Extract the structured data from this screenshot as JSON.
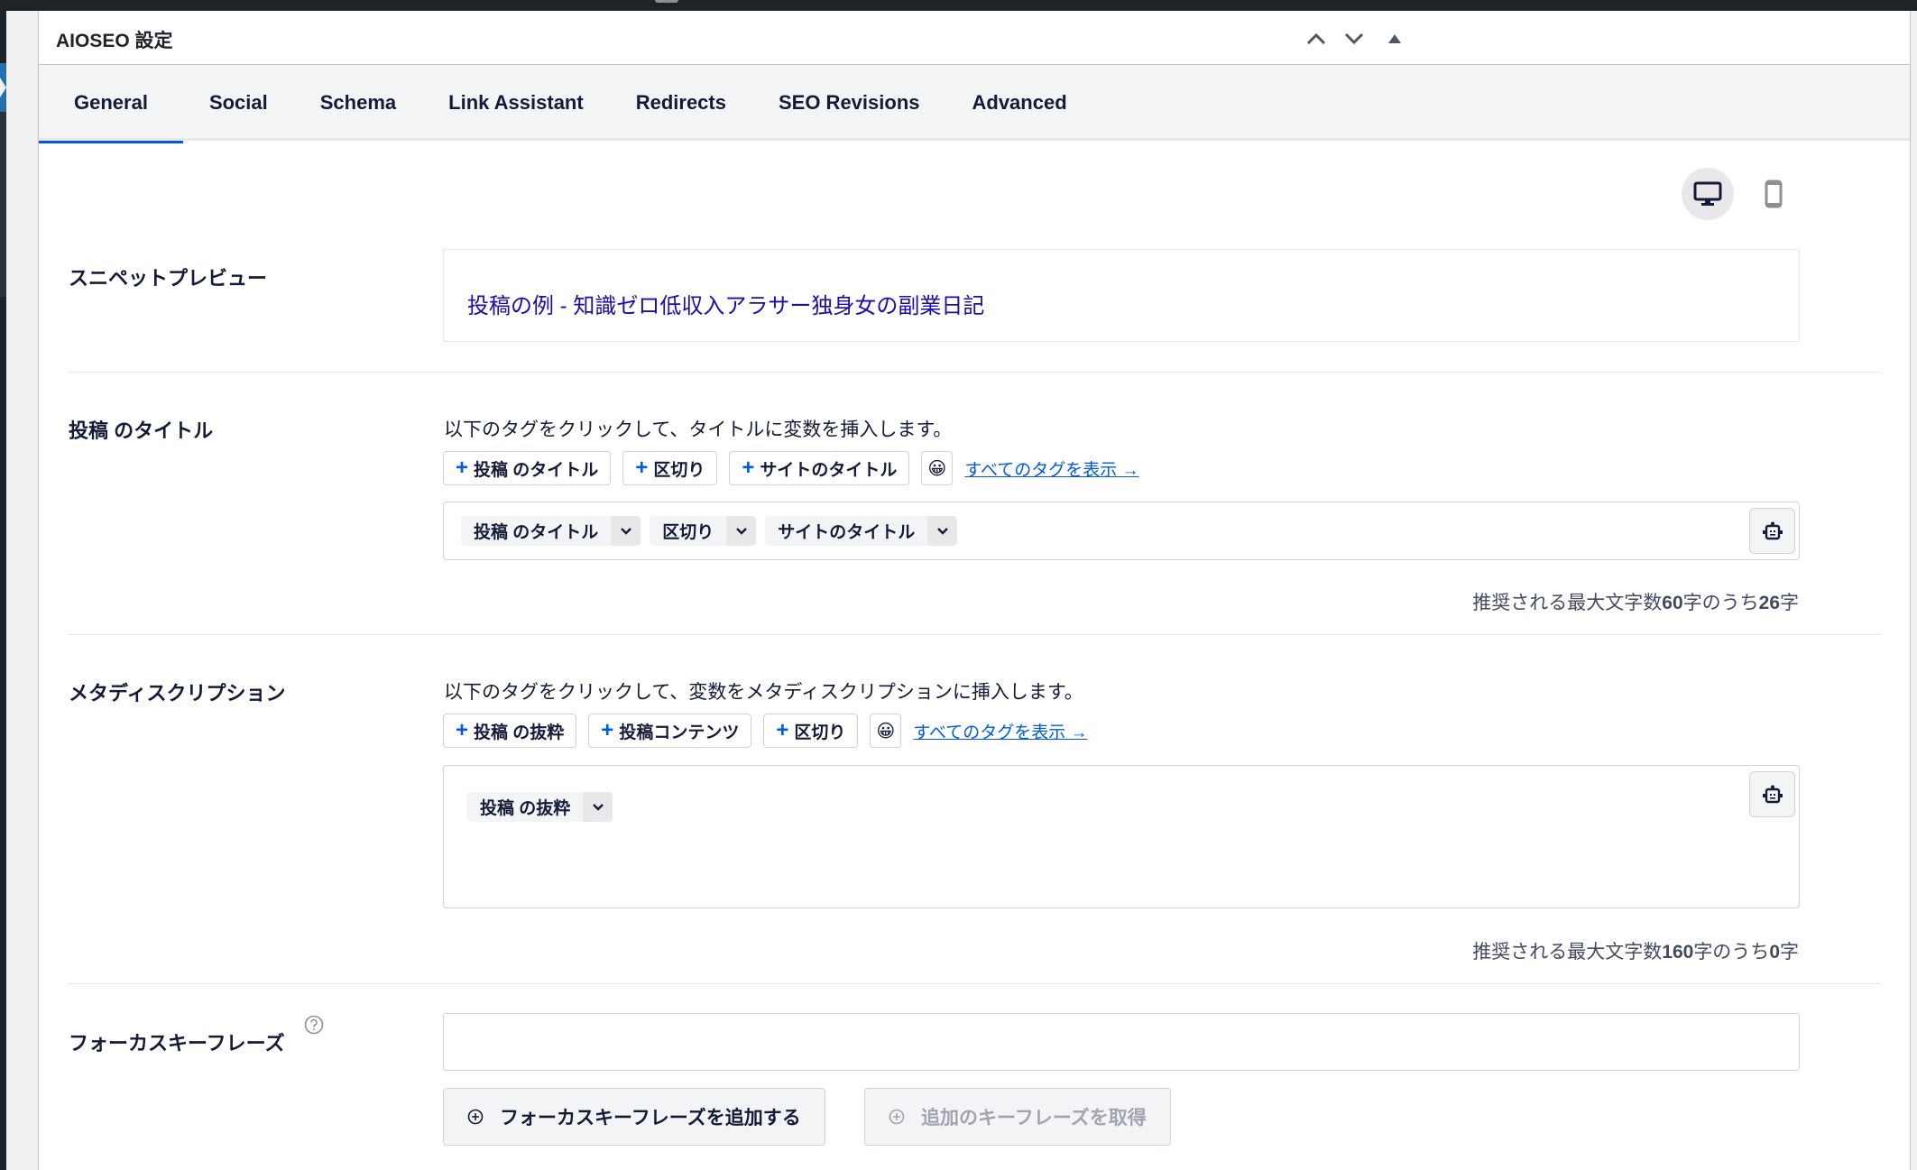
{
  "panel": {
    "title": "AIOSEO 設定",
    "header_controls": [
      "move-up",
      "move-down",
      "collapse"
    ]
  },
  "tabs": [
    {
      "label": "General",
      "active": true
    },
    {
      "label": "Social",
      "active": false
    },
    {
      "label": "Schema",
      "active": false
    },
    {
      "label": "Link Assistant",
      "active": false
    },
    {
      "label": "Redirects",
      "active": false
    },
    {
      "label": "SEO Revisions",
      "active": false
    },
    {
      "label": "Advanced",
      "active": false
    }
  ],
  "preview_devices": [
    {
      "name": "desktop",
      "active": true
    },
    {
      "name": "mobile",
      "active": false
    }
  ],
  "snippet_preview": {
    "label": "スニペットプレビュー",
    "title": "投稿の例 - 知識ゼロ低収入アラサー独身女の副業日記"
  },
  "post_title": {
    "label": "投稿 のタイトル",
    "description": "以下のタグをクリックして、タイトルに変数を挿入します。",
    "tag_buttons": [
      "投稿 のタイトル",
      "区切り",
      "サイトのタイトル"
    ],
    "emoji": "😀",
    "view_all_tags": "すべてのタグを表示 →",
    "chips": [
      "投稿 のタイトル",
      "区切り",
      "サイトのタイトル"
    ],
    "count_prefix": "推奨される最大文字数",
    "count_max": "60",
    "count_mid": "字のうち",
    "count_current": "26",
    "count_suffix": "字"
  },
  "meta_description": {
    "label": "メタディスクリプション",
    "description": "以下のタグをクリックして、変数をメタディスクリプションに挿入します。",
    "tag_buttons": [
      "投稿 の抜粋",
      "投稿コンテンツ",
      "区切り"
    ],
    "emoji": "😀",
    "view_all_tags": "すべてのタグを表示 →",
    "chips": [
      "投稿 の抜粋"
    ],
    "count_prefix": "推奨される最大文字数",
    "count_max": "160",
    "count_mid": "字のうち",
    "count_current": "0",
    "count_suffix": "字"
  },
  "focus_keyphrase": {
    "label": "フォーカスキーフレーズ",
    "input_value": "",
    "add_button": "フォーカスキーフレーズを追加する",
    "get_more_button": "追加のキーフレーズを取得"
  },
  "colors": {
    "accent": "#005ae0",
    "preview_title": "#1a0dab",
    "text": "#141b38"
  }
}
